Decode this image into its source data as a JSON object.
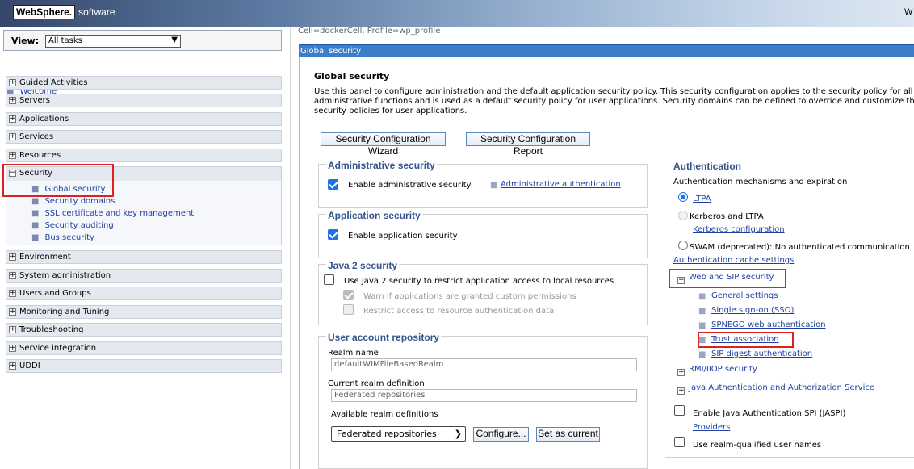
{
  "banner": {
    "logo": "WebSphere.",
    "logo_suffix": "software",
    "right_text": "W"
  },
  "nav": {
    "view_label": "View:",
    "view_value": "All tasks",
    "welcome": "Welcome",
    "items": [
      "Guided Activities",
      "Servers",
      "Applications",
      "Services",
      "Resources"
    ],
    "security": {
      "label": "Security",
      "sub": [
        "Global security",
        "Security domains",
        "SSL certificate and key management",
        "Security auditing",
        "Bus security"
      ]
    },
    "items_after": [
      "Environment",
      "System administration",
      "Users and Groups",
      "Monitoring and Tuning",
      "Troubleshooting",
      "Service integration",
      "UDDI"
    ]
  },
  "content": {
    "breadcrumb": "Cell=dockerCell, Profile=wp_profile",
    "titlebar": "Global security",
    "page_title": "Global security",
    "description": "Use this panel to configure administration and the default application security policy. This security configuration applies to the security policy for all administrative functions and is used as a default security policy for user applications. Security domains can be defined to override and customize the security policies for user applications.",
    "btn_wizard": "Security Configuration Wizard",
    "btn_report": "Security Configuration Report",
    "admin_security": {
      "title": "Administrative security",
      "enable": "Enable administrative security",
      "link": "Administrative authentication"
    },
    "app_security": {
      "title": "Application security",
      "enable": "Enable application security"
    },
    "java2": {
      "title": "Java 2 security",
      "use": "Use Java 2 security to restrict application access to local resources",
      "warn": "Warn if applications are granted custom permissions",
      "restrict": "Restrict access to resource authentication data"
    },
    "repo": {
      "title": "User account repository",
      "realm_label": "Realm name",
      "realm_value": "defaultWIMFileBasedRealm",
      "current_label": "Current realm definition",
      "current_value": "Federated repositories",
      "available_label": "Available realm definitions",
      "available_value": "Federated repositories",
      "configure": "Configure...",
      "set_current": "Set as current"
    },
    "auth": {
      "title": "Authentication",
      "mech": "Authentication mechanisms and expiration",
      "ltpa": "LTPA",
      "kerberos": "Kerberos and LTPA",
      "kerberos_link": "Kerberos configuration",
      "swam": "SWAM (deprecated): No authenticated communication",
      "cache": "Authentication cache settings",
      "web_sip": "Web and SIP security",
      "web_links": [
        "General settings",
        "Single sign-on (SSO)",
        "SPNEGO web authentication",
        "Trust association",
        "SIP digest authentication"
      ],
      "rmi": "RMI/IIOP security",
      "jaas": "Java Authentication and Authorization Service",
      "jaspi": "Enable Java Authentication SPI (JASPI)",
      "providers": "Providers",
      "realm_names": "Use realm-qualified user names"
    }
  },
  "colors": {
    "accent": "#3c7fc8",
    "highlight": "#e02020",
    "link": "#1f3fa0"
  }
}
